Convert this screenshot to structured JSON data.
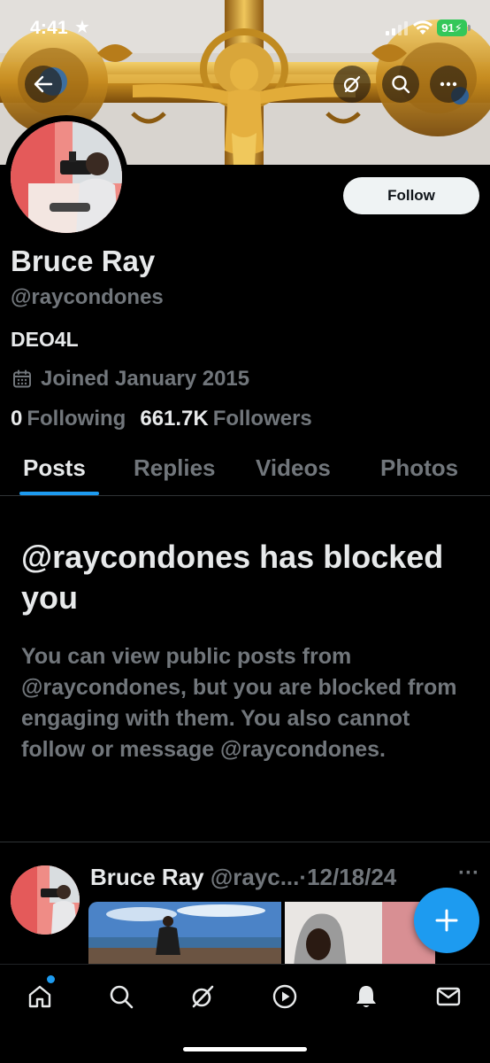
{
  "status_bar": {
    "time": "4:41",
    "battery": "91"
  },
  "header": {
    "back_icon": "arrow-left-icon",
    "grok_icon": "grok-icon",
    "search_icon": "search-icon",
    "more_icon": "more-horizontal-icon"
  },
  "profile": {
    "display_name": "Bruce Ray",
    "handle": "@raycondones",
    "bio": "DEO4L",
    "joined": "Joined January 2015",
    "following_count": "0",
    "following_label": "Following",
    "followers_count": "661.7K",
    "followers_label": "Followers",
    "follow_button": "Follow"
  },
  "tabs": [
    {
      "label": "Posts",
      "active": true
    },
    {
      "label": "Replies",
      "active": false
    },
    {
      "label": "Videos",
      "active": false
    },
    {
      "label": "Photos",
      "active": false
    }
  ],
  "blocked_notice": {
    "title": "@raycondones has blocked you",
    "body": "You can view public posts from @raycondones, but you are blocked from engaging with them. You also cannot follow or message @raycondones."
  },
  "post": {
    "author_name": "Bruce Ray",
    "author_handle": "@rayc...",
    "separator": "·",
    "date": "12/18/24",
    "more": "···"
  },
  "fab": {
    "icon": "plus-icon"
  },
  "bottom_nav": [
    {
      "icon": "home-icon"
    },
    {
      "icon": "search-icon"
    },
    {
      "icon": "grok-icon"
    },
    {
      "icon": "play-icon"
    },
    {
      "icon": "bell-icon"
    },
    {
      "icon": "mail-icon"
    }
  ],
  "colors": {
    "accent": "#1d9bf0",
    "text_primary": "#e7e9ea",
    "text_secondary": "#71767b",
    "battery": "#34c759"
  }
}
